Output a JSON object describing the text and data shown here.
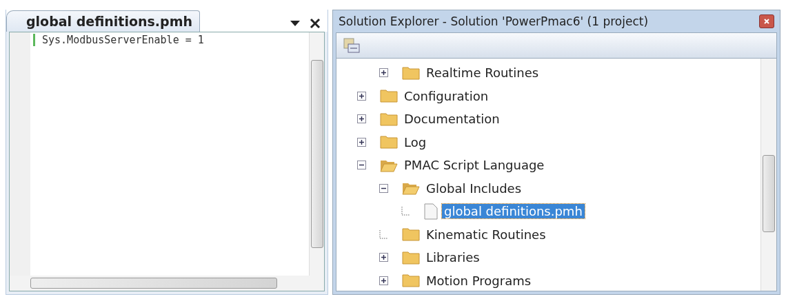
{
  "editor": {
    "tab": {
      "label": "global definitions.pmh",
      "selected": true
    },
    "lines": [
      "Sys.ModbusServerEnable = 1"
    ]
  },
  "explorer": {
    "title": "Solution Explorer - Solution 'PowerPmac6' (1 project)",
    "tree": {
      "continued_children": [
        {
          "label": "Realtime Routines",
          "kind": "folder",
          "expandable": true,
          "expanded": false,
          "selected": false
        }
      ],
      "items": [
        {
          "label": "Configuration",
          "kind": "folder",
          "expandable": true,
          "expanded": false,
          "selected": false
        },
        {
          "label": "Documentation",
          "kind": "folder",
          "expandable": true,
          "expanded": false,
          "selected": false
        },
        {
          "label": "Log",
          "kind": "folder",
          "expandable": true,
          "expanded": false,
          "selected": false
        },
        {
          "label": "PMAC Script Language",
          "kind": "folder",
          "expandable": true,
          "expanded": true,
          "selected": false,
          "children": [
            {
              "label": "Global Includes",
              "kind": "folder",
              "expandable": true,
              "expanded": true,
              "selected": false,
              "children": [
                {
                  "label": "global definitions.pmh",
                  "kind": "file",
                  "expandable": false,
                  "expanded": false,
                  "selected": true
                }
              ]
            },
            {
              "label": "Kinematic Routines",
              "kind": "folder",
              "expandable": false,
              "expanded": false,
              "selected": false
            },
            {
              "label": "Libraries",
              "kind": "folder",
              "expandable": true,
              "expanded": false,
              "selected": false
            },
            {
              "label": "Motion Programs",
              "kind": "folder",
              "expandable": true,
              "expanded": false,
              "selected": false
            }
          ]
        }
      ]
    }
  }
}
